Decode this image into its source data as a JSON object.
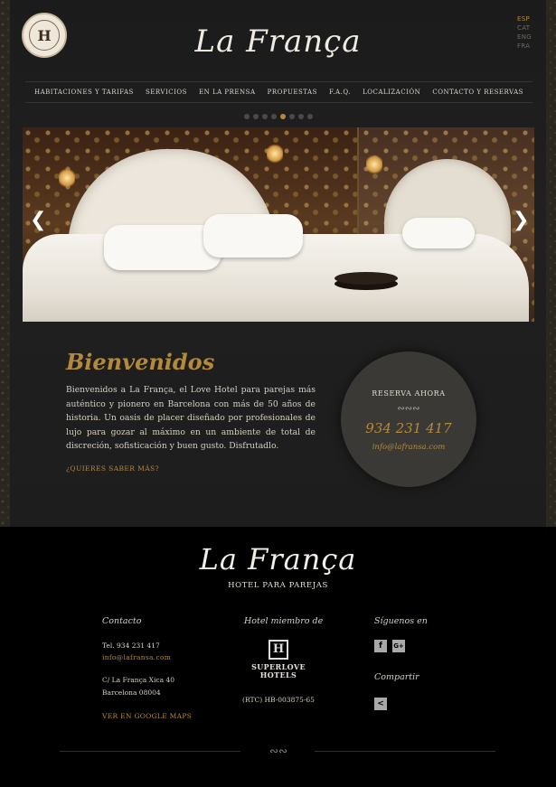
{
  "brand": {
    "title": "La França",
    "badge_letter": "H"
  },
  "languages": [
    {
      "code": "ESP",
      "active": true
    },
    {
      "code": "CAT",
      "active": false
    },
    {
      "code": "ENG",
      "active": false
    },
    {
      "code": "FRA",
      "active": false
    }
  ],
  "nav": {
    "items": [
      "HABITACIONES Y TARIFAS",
      "SERVICIOS",
      "EN LA PRENSA",
      "PROPUESTAS",
      "F.A.Q.",
      "LOCALIZACIÓN",
      "CONTACTO Y RESERVAS"
    ]
  },
  "slider": {
    "slide_count": 8,
    "active_index": 4,
    "prev_icon": "chevron-left-icon",
    "next_icon": "chevron-right-icon"
  },
  "welcome": {
    "title": "Bienvenidos",
    "text": "Bienvenidos a La França, el Love Hotel para parejas más auténtico y pionero en Barcelona con más de 50 años de historia. Un oasis de placer diseñado por profesionales de lujo para gozar al máximo en un ambiente de total de discreción, sofisticación y buen gusto. Disfrutadlo.",
    "more_link": "¿QUIERES SABER MÁS?"
  },
  "booking": {
    "title": "RESERVA AHORA",
    "phone": "934 231 417",
    "email": "info@lafransa.com"
  },
  "footer": {
    "title": "La França",
    "subtitle": "HOTEL PARA PAREJAS",
    "contact": {
      "heading": "Contacto",
      "phone": "Tel. 934 231 417",
      "email": "info@lafransa.com",
      "address_line1": "C/ La França Xica 40",
      "address_line2": "Barcelona 08004",
      "maps_link": "VER EN GOOGLE MAPS"
    },
    "member": {
      "heading": "Hotel miembro de",
      "logo_letter": "H",
      "logo_line1": "SUPERLOVE",
      "logo_line2": "HOTELS",
      "rtc": "(RTC) HB-003875-65"
    },
    "social": {
      "follow_heading": "Síguenos en",
      "share_heading": "Compartir",
      "facebook_label": "f",
      "googleplus_label": "G+",
      "share_label": "<"
    }
  },
  "colors": {
    "accent": "#b48a3a",
    "background": "#1d1d1d",
    "footer_bg": "#000000"
  }
}
